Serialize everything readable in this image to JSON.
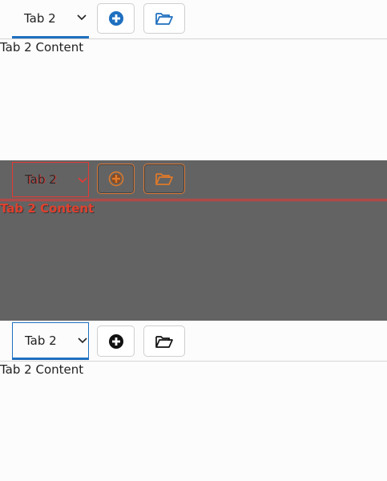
{
  "panels": [
    {
      "variant": "normal",
      "tab": {
        "label": "Tab 2"
      },
      "content": "Tab 2 Content",
      "colors": {
        "accent": "#1e6fbf",
        "icon": "#1e6fbf"
      }
    },
    {
      "variant": "debug-overlay",
      "tab": {
        "label": "Tab 2"
      },
      "content": "Tab 2 Content",
      "colors": {
        "outline": "#e53935",
        "icon": "#e07a2a",
        "background": "#636363"
      }
    },
    {
      "variant": "focused",
      "tab": {
        "label": "Tab 2"
      },
      "content": "Tab 2 Content",
      "colors": {
        "accent": "#1e6fbf",
        "icon": "#111111"
      }
    }
  ],
  "toolbar": {
    "add_icon": "plus-circle-icon",
    "open_icon": "folder-open-icon",
    "tab_icon": "chevron-down-icon"
  }
}
